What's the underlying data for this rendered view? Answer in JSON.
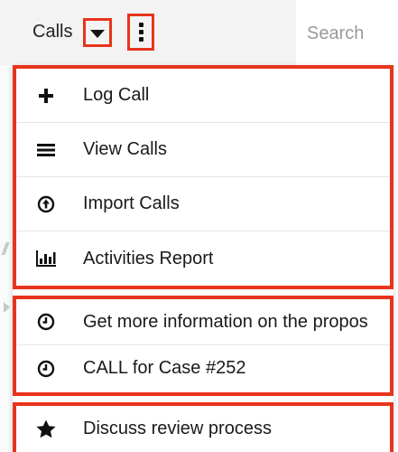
{
  "header": {
    "module_label": "Calls",
    "search": {
      "placeholder": "Search"
    }
  },
  "menu": {
    "actions": [
      {
        "label": "Log Call",
        "icon": "plus-icon"
      },
      {
        "label": "View Calls",
        "icon": "list-icon"
      },
      {
        "label": "Import Calls",
        "icon": "upload-circle-icon"
      },
      {
        "label": "Activities Report",
        "icon": "bar-chart-icon"
      }
    ],
    "recent": [
      {
        "label": "Get more information on the propos",
        "icon": "clock-icon"
      },
      {
        "label": "CALL for Case #252",
        "icon": "clock-icon"
      }
    ],
    "favorites": [
      {
        "label": "Discuss review process",
        "icon": "star-icon"
      }
    ]
  },
  "colors": {
    "highlight": "#e8341c",
    "module_bg": "#f3f3f3",
    "text": "#1a1a1a",
    "placeholder": "#9a9a9a"
  }
}
